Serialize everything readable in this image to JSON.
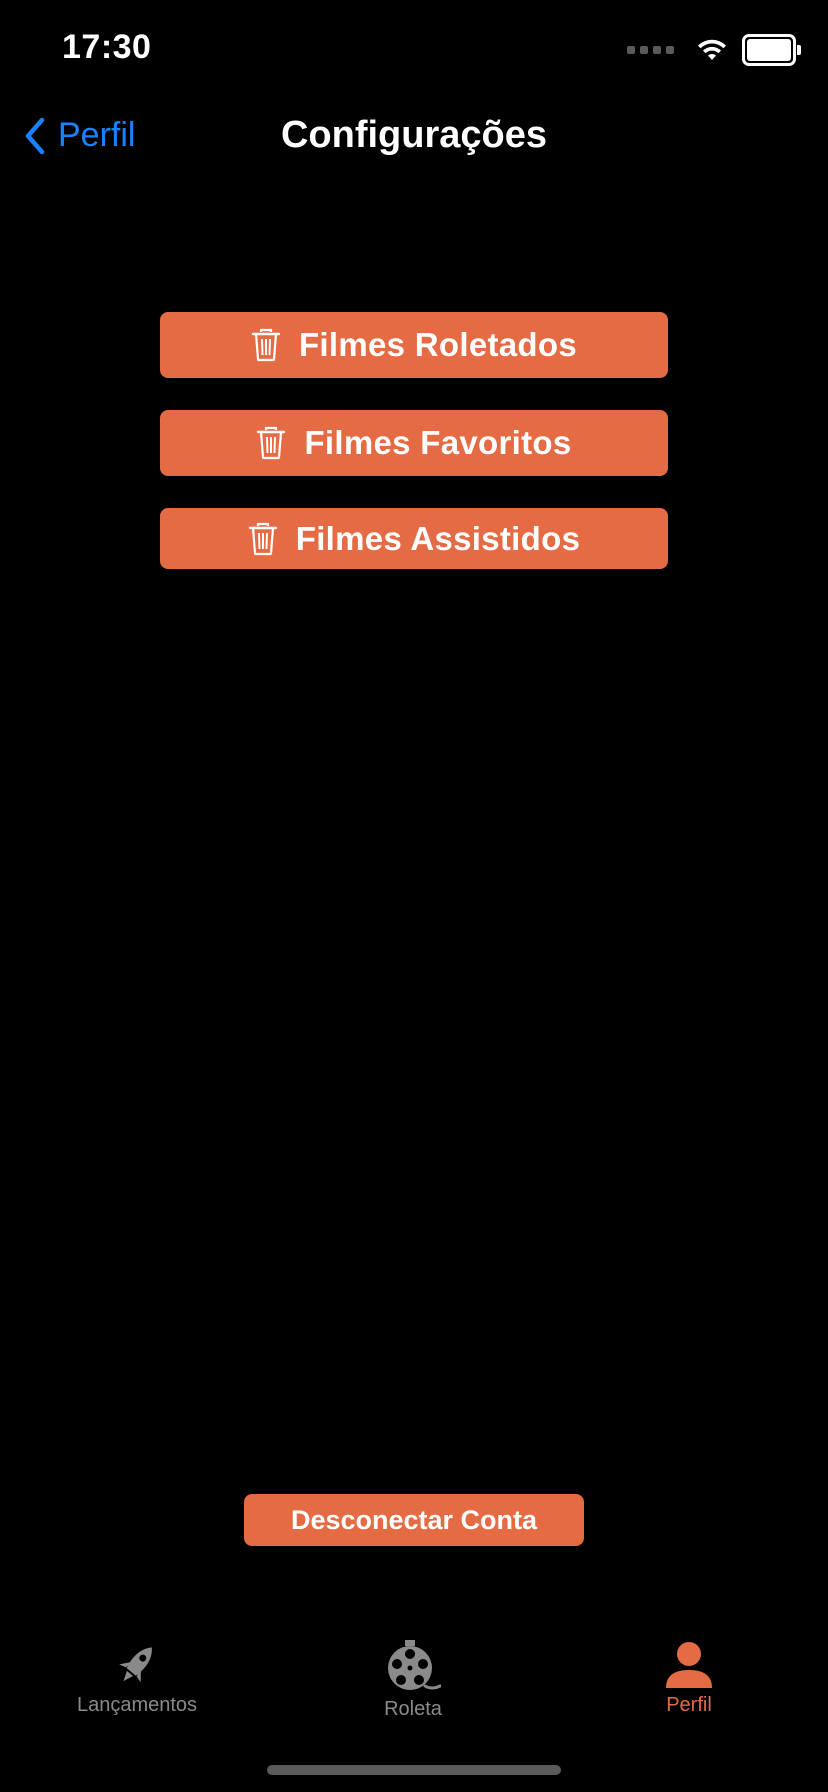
{
  "status_bar": {
    "time": "17:30"
  },
  "nav": {
    "back_label": "Perfil",
    "title": "Configurações",
    "accent_color": "#1a82ff"
  },
  "actions": [
    {
      "label": "Filmes Roletados",
      "icon": "trash-icon"
    },
    {
      "label": "Filmes Favoritos",
      "icon": "trash-icon"
    },
    {
      "label": "Filmes Assistidos",
      "icon": "trash-icon"
    }
  ],
  "disconnect": {
    "label": "Desconectar Conta"
  },
  "tab_bar": {
    "tabs": [
      {
        "label": "Lançamentos",
        "icon": "rocket-icon",
        "active": false
      },
      {
        "label": "Roleta",
        "icon": "film-reel-icon",
        "active": false
      },
      {
        "label": "Perfil",
        "icon": "person-icon",
        "active": true
      }
    ]
  },
  "colors": {
    "background": "#000000",
    "button": "#e46b43",
    "tab_inactive": "#8a8a8a",
    "tab_active": "#e46b43"
  }
}
